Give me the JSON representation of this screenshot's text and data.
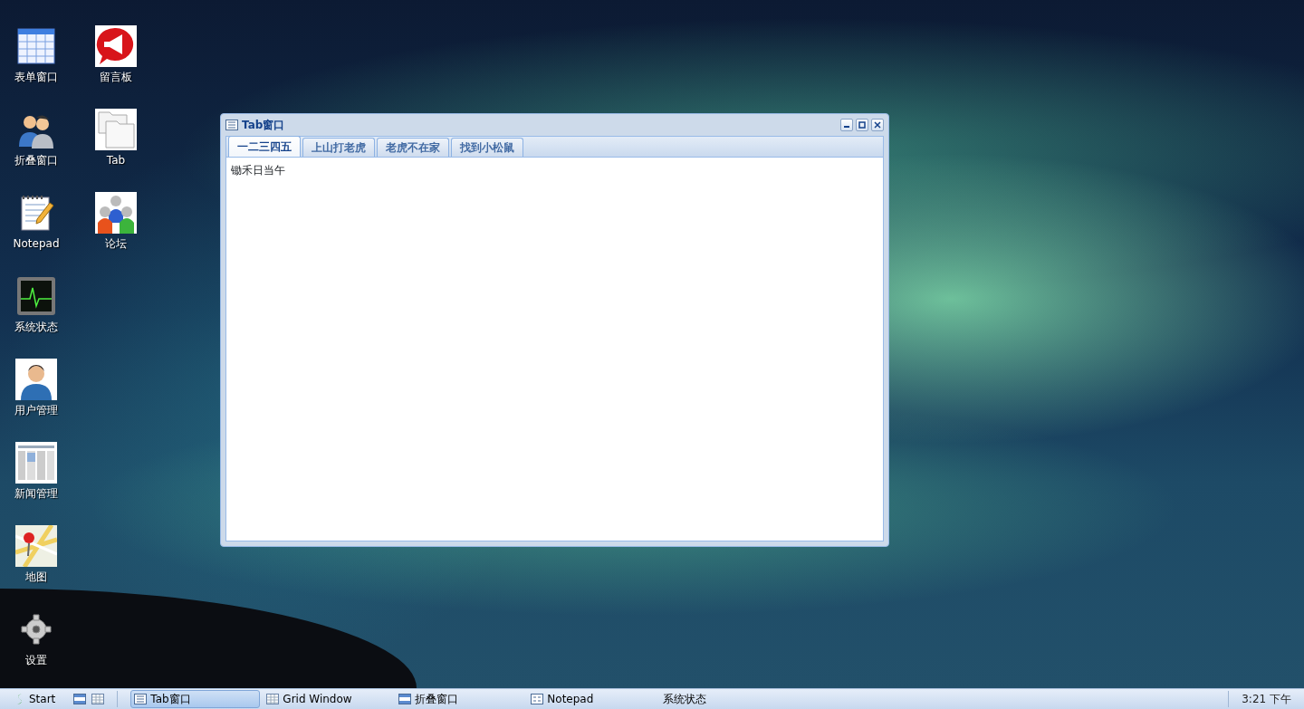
{
  "desktop_icons": [
    {
      "label": "表单窗口",
      "kind": "grid"
    },
    {
      "label": "折叠窗口",
      "kind": "users"
    },
    {
      "label": "Notepad",
      "kind": "notepad"
    },
    {
      "label": "系统状态",
      "kind": "monitor"
    },
    {
      "label": "用户管理",
      "kind": "user"
    },
    {
      "label": "新闻管理",
      "kind": "news"
    },
    {
      "label": "地图",
      "kind": "map"
    },
    {
      "label": "设置",
      "kind": "gear"
    },
    {
      "label": "留言板",
      "kind": "megaphone"
    },
    {
      "label": "Tab",
      "kind": "folders"
    },
    {
      "label": "论坛",
      "kind": "group"
    }
  ],
  "window": {
    "title": "Tab窗口",
    "tabs": [
      {
        "label": "一二三四五",
        "selected": true
      },
      {
        "label": "上山打老虎",
        "selected": false
      },
      {
        "label": "老虎不在家",
        "selected": false
      },
      {
        "label": "找到小松鼠",
        "selected": false
      }
    ],
    "content": "锄禾日当午"
  },
  "taskbar": {
    "start": "Start",
    "tasks": [
      {
        "label": "Tab窗口",
        "kind": "tab",
        "selected": true
      },
      {
        "label": "Grid Window",
        "kind": "grid",
        "selected": false
      },
      {
        "label": "折叠窗口",
        "kind": "accordion",
        "selected": false
      },
      {
        "label": "Notepad",
        "kind": "form",
        "selected": false
      },
      {
        "label": "系统状态",
        "kind": "none",
        "selected": false
      }
    ],
    "clock": "3:21 下午"
  }
}
